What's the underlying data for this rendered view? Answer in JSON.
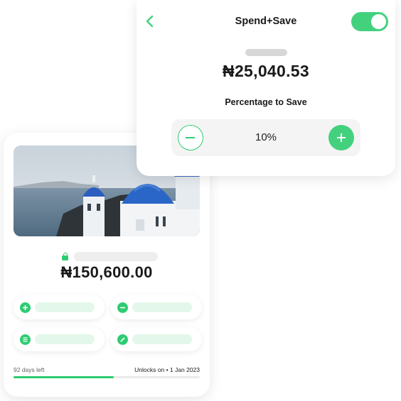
{
  "spend_save": {
    "title": "Spend+Save",
    "toggle_on": true,
    "balance": "₦25,040.53",
    "percentage_label": "Percentage to Save",
    "percentage_value": "10%",
    "back_icon": "chevron-left-icon",
    "decrease_icon": "minus-icon",
    "increase_icon": "plus-icon"
  },
  "savings_goal": {
    "image": "santorini-blue-domes-photo",
    "amount": "₦150,600.00",
    "lock_icon": "lock-icon",
    "actions": [
      {
        "icon": "plus-icon"
      },
      {
        "icon": "minus-icon"
      },
      {
        "icon": "list-icon"
      },
      {
        "icon": "pencil-icon"
      }
    ],
    "days_left": "92 days left",
    "unlocks_label": "Unlocks on",
    "unlocks_date": "1 Jan 2023",
    "progress": 0.54
  },
  "colors": {
    "accent": "#43d17e",
    "accent_light": "#e3f8ea",
    "placeholder": "#d7d7d7"
  }
}
